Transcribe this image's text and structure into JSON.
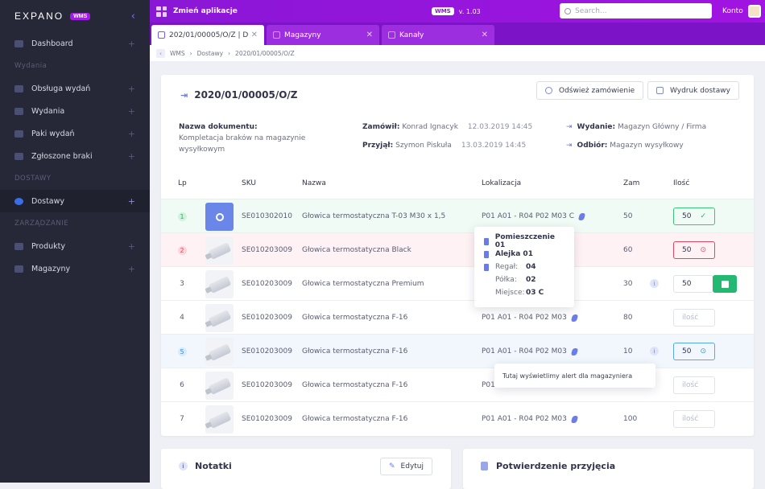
{
  "sidebar": {
    "logo": "EXPANO",
    "badge": "WMS",
    "items": [
      {
        "label": "Dashboard"
      },
      {
        "section": "Wydania"
      },
      {
        "label": "Obsługa wydań"
      },
      {
        "label": "Wydania"
      },
      {
        "label": "Paki wydań"
      },
      {
        "label": "Zgłoszone braki"
      },
      {
        "section": "DOSTAWY"
      },
      {
        "label": "Dostawy",
        "active": true
      },
      {
        "section": "ZARZĄDZANIE"
      },
      {
        "label": "Produkty"
      },
      {
        "label": "Magazyny"
      }
    ]
  },
  "topbar": {
    "app_switch": "Zmień aplikacje",
    "badge": "WMS",
    "version": "v. 1.03",
    "search_placeholder": "Search...",
    "account": "Konto"
  },
  "tabs": [
    "202/01/00005/O/Z | Do...",
    "Magazyny",
    "Kanały"
  ],
  "breadcrumb": [
    "WMS",
    "Dostawy",
    "2020/01/00005/O/Z"
  ],
  "order": {
    "title": "2020/01/00005/O/Z",
    "refresh": "Odśwież zamówienie",
    "print": "Wydruk dostawy"
  },
  "meta": {
    "doc_label": "Nazwa dokumentu:",
    "doc_value": "Kompletacja braków na magazynie wysyłkowym",
    "ordered_label": "Zamówił:",
    "ordered_by": "Konrad Ignacyk",
    "ordered_date": "12.03.2019 14:45",
    "received_label": "Przyjął:",
    "received_by": "Szymon Piskuła",
    "received_date": "13.03.2019 14:45",
    "release_label": "Wydanie:",
    "release_value": "Magazyn Główny / Firma",
    "pickup_label": "Odbiór:",
    "pickup_value": "Magazyn wysyłkowy"
  },
  "table": {
    "headers": [
      "Lp",
      "SKU",
      "Nazwa",
      "Lokalizacja",
      "Zam",
      "Ilość"
    ],
    "rows": [
      {
        "lp": "1",
        "sku": "SE010302010",
        "name": "Głowica termostatyczna T-03 M30 x 1,5",
        "loc": "P01 A01 - R04 P02 M03 C",
        "zam": "50",
        "qty": "50",
        "state": "ok"
      },
      {
        "lp": "2",
        "sku": "SE010203009",
        "name": "Głowica termostatyczna Black",
        "loc": "",
        "zam": "60",
        "qty": "50",
        "state": "err"
      },
      {
        "lp": "3",
        "sku": "SE010203009",
        "name": "Głowica termostatyczna Premium",
        "loc": "",
        "zam": "30",
        "qty": "50",
        "state": "save"
      },
      {
        "lp": "4",
        "sku": "SE010203009",
        "name": "Głowica termostatyczna F-16",
        "loc": "P01 A01 - R04 P02 M03",
        "zam": "80",
        "qty": "ilość",
        "state": "empty"
      },
      {
        "lp": "5",
        "sku": "SE010203009",
        "name": "Głowica termostatyczna F-16",
        "loc": "P01 A01 - R04 P02 M03",
        "zam": "10",
        "qty": "50",
        "state": "inf"
      },
      {
        "lp": "6",
        "sku": "SE010203009",
        "name": "Głowica termostatyczna F-16",
        "loc": "P01",
        "zam": "",
        "qty": "ilość",
        "state": "empty"
      },
      {
        "lp": "7",
        "sku": "SE010203009",
        "name": "Głowica termostatyczna F-16",
        "loc": "P01 A01 - R04 P02 M03",
        "zam": "100",
        "qty": "ilość",
        "state": "empty"
      }
    ]
  },
  "popover": {
    "room": "Pomieszczenie 01",
    "aisle": "Alejka 01",
    "rack_label": "Regał:",
    "rack": "04",
    "shelf_label": "Półka:",
    "shelf": "02",
    "place_label": "Miejsce:",
    "place": "03 C"
  },
  "alert": "Tutaj wyświetlimy alert dla magazyniera",
  "notes": {
    "title": "Notatki",
    "edit": "Edytuj"
  },
  "confirm": {
    "title": "Potwierdzenie przyjęcia"
  }
}
